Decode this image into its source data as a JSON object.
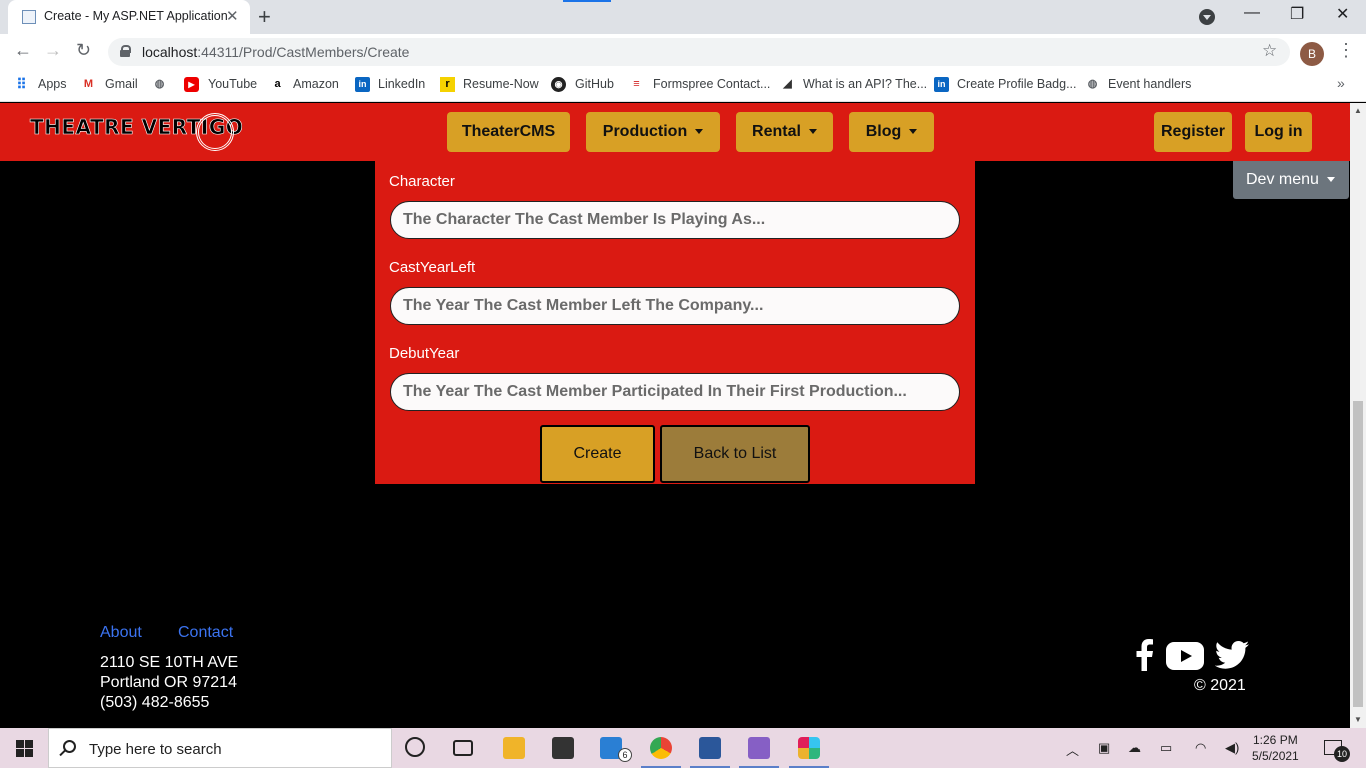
{
  "browser": {
    "tab_title": "Create - My ASP.NET Application",
    "url_host": "localhost",
    "url_rest": ":44311/Prod/CastMembers/Create",
    "profile_initial": "B",
    "bookmarks": [
      {
        "label": "Apps",
        "icon": "apps-grid-icon"
      },
      {
        "label": "Gmail",
        "icon": "gmail-icon"
      },
      {
        "label": "",
        "icon": "globe-icon"
      },
      {
        "label": "YouTube",
        "icon": "youtube-icon"
      },
      {
        "label": "Amazon",
        "icon": "amazon-icon"
      },
      {
        "label": "LinkedIn",
        "icon": "linkedin-icon"
      },
      {
        "label": "Resume-Now",
        "icon": "resume-now-icon"
      },
      {
        "label": "GitHub",
        "icon": "github-icon"
      },
      {
        "label": "Formspree Contact...",
        "icon": "formspree-icon"
      },
      {
        "label": "What is an API? The...",
        "icon": "api-icon"
      },
      {
        "label": "Create Profile Badg...",
        "icon": "linkedin-icon"
      },
      {
        "label": "Event handlers",
        "icon": "globe-icon"
      }
    ]
  },
  "site": {
    "logo": "THEATRE VERTIGO",
    "nav": {
      "theatercms": "TheaterCMS",
      "production": "Production",
      "rental": "Rental",
      "blog": "Blog",
      "register": "Register",
      "login": "Log in",
      "dev_menu": "Dev menu"
    },
    "form": {
      "character_label": "Character",
      "character_placeholder": "The Character The Cast Member Is Playing As...",
      "castyearleft_label": "CastYearLeft",
      "castyearleft_placeholder": "The Year The Cast Member Left The Company...",
      "debutyear_label": "DebutYear",
      "debutyear_placeholder": "The Year The Cast Member Participated In Their First Production...",
      "create_button": "Create",
      "back_button": "Back to List"
    },
    "footer": {
      "about": "About",
      "contact": "Contact",
      "address_line1": "2110 SE 10TH AVE",
      "address_line2": "Portland OR 97214",
      "phone": "(503) 482-8655",
      "copyright": "© 2021"
    },
    "colors": {
      "brand_red": "#da1a12",
      "gold": "#d8a025",
      "back_button": "#9c7c3a",
      "dev_menu": "#6c757d",
      "footer_link": "#3b73f0"
    }
  },
  "taskbar": {
    "search_placeholder": "Type here to search",
    "mail_badge": "6",
    "time": "1:26 PM",
    "date": "5/5/2021",
    "notification_count": "10"
  }
}
